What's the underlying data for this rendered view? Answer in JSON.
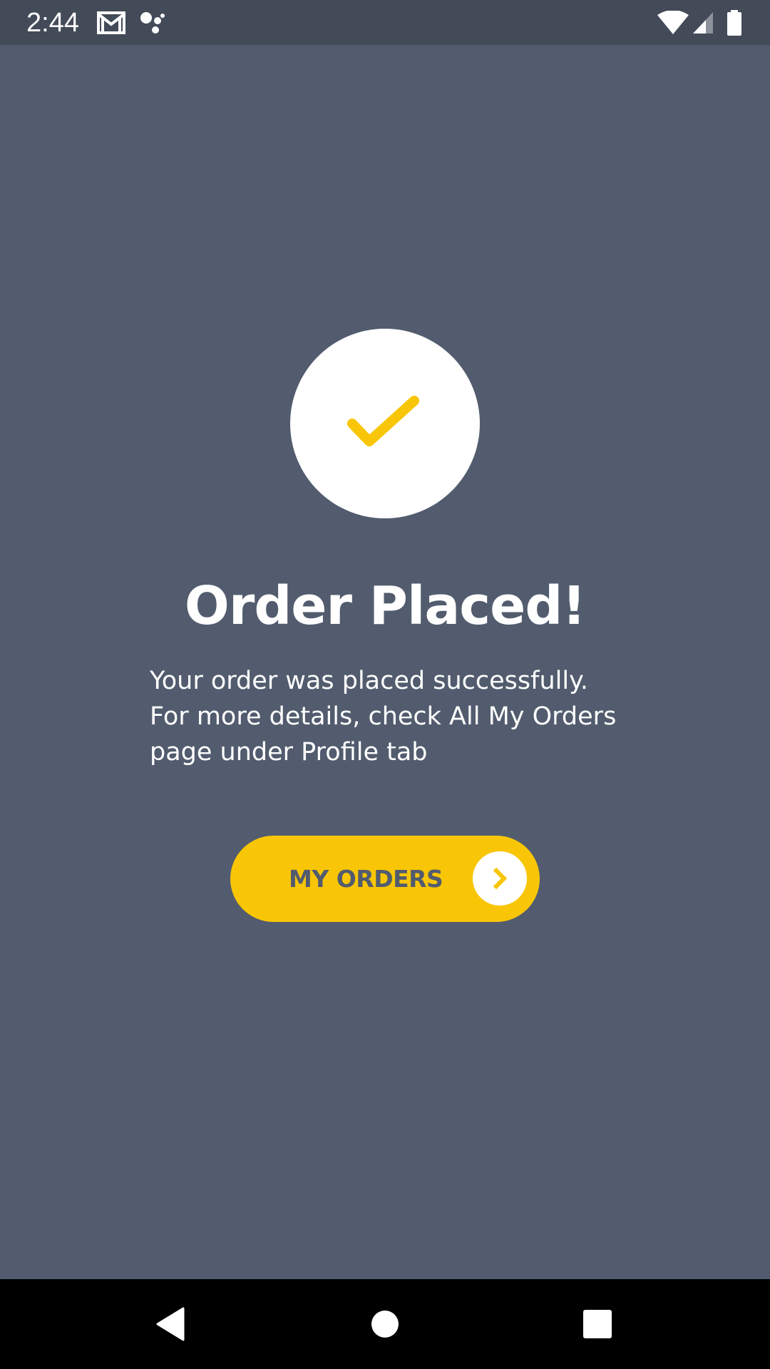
{
  "status_bar": {
    "time": "2:44",
    "icons": [
      "gmail-icon",
      "assistant-icon",
      "wifi-icon",
      "signal-icon",
      "battery-icon"
    ]
  },
  "main": {
    "icon": "checkmark-icon",
    "title": "Order Placed!",
    "message": "Your order was placed successfully.\n For more details, check All My Orders\npage under Profile tab",
    "button": {
      "label": "MY ORDERS",
      "icon": "chevron-right-icon"
    }
  },
  "nav_bar": {
    "buttons": [
      "back-icon",
      "home-icon",
      "recents-icon"
    ]
  },
  "colors": {
    "background": "#525c6e",
    "status_bar": "#434a58",
    "accent": "#f8c606",
    "button_text": "#525c6e",
    "white": "#ffffff"
  }
}
